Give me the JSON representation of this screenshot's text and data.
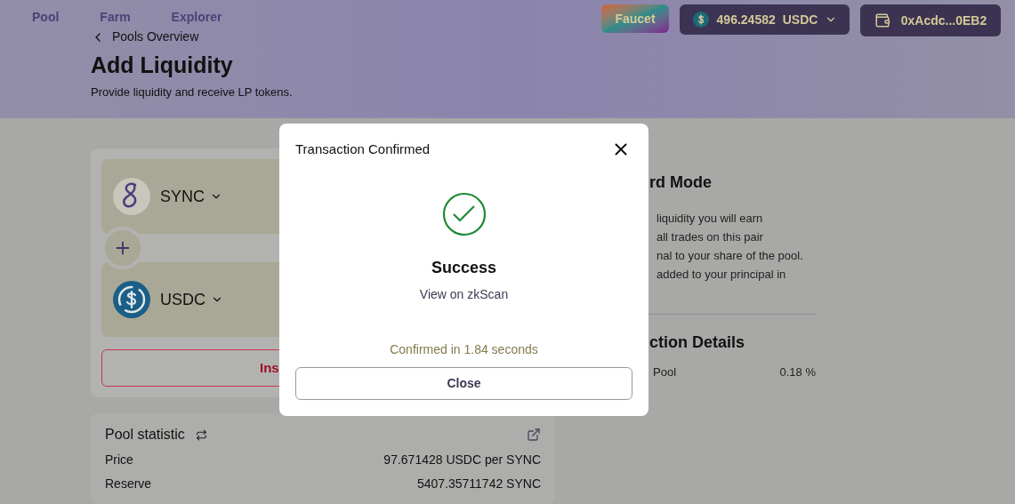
{
  "nav": [
    {
      "label": "Pool"
    },
    {
      "label": "Farm"
    },
    {
      "label": "Explorer"
    }
  ],
  "header": {
    "faucet": "Faucet",
    "balance": {
      "amount": "496.24582",
      "currency": "USDC"
    },
    "wallet": "0xAcdc...0EB2"
  },
  "breadcrumb": "Pools Overview",
  "page": {
    "title": "Add Liquidity",
    "subtitle": "Provide liquidity and receive LP tokens."
  },
  "tokens": [
    {
      "symbol": "SYNC",
      "kind": "sync"
    },
    {
      "symbol": "USDC",
      "kind": "usdc"
    }
  ],
  "action_button": "Ins",
  "pool_statistic": {
    "title": "Pool statistic",
    "rows": [
      {
        "label": "Price",
        "value": "97.671428 USDC per SYNC"
      },
      {
        "label": "Reserve",
        "value": "5407.35711742 SYNC"
      }
    ]
  },
  "side": {
    "mode_title": "rd Mode",
    "mode_lines": [
      "liquidity you will earn",
      "all trades on this pair",
      "nal to your share of the pool.",
      "added to your principal in"
    ],
    "details_title": "ction Details",
    "details_rows": [
      {
        "label": "Pool",
        "value": "0.18 %"
      }
    ]
  },
  "modal": {
    "title": "Transaction Confirmed",
    "status": "Success",
    "link": "View on zkScan",
    "confirmed": "Confirmed in 1.84 seconds",
    "close_button": "Close"
  }
}
